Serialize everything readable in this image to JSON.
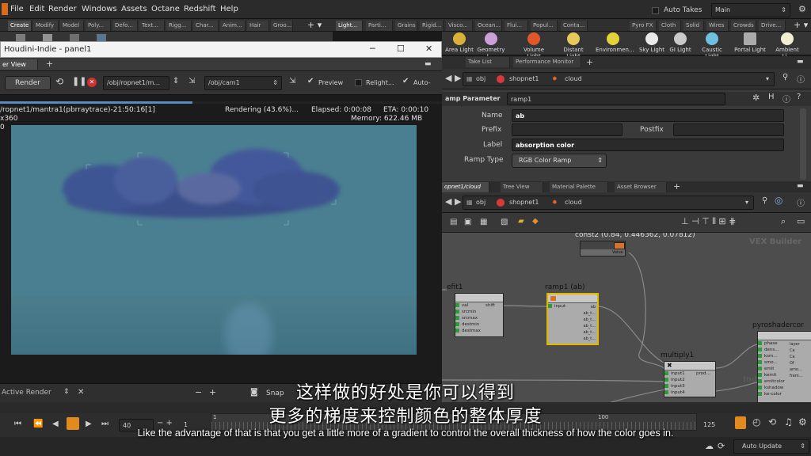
{
  "menubar": {
    "items": [
      "File",
      "Edit",
      "Render",
      "Windows",
      "Assets",
      "Octane",
      "Redshift",
      "Help"
    ],
    "auto_takes": "Auto Takes",
    "desktop": "Main"
  },
  "shelf_left": {
    "tabs": [
      "Create",
      "Modify",
      "Model",
      "Poly...",
      "Defo...",
      "Text...",
      "Rigg...",
      "Char...",
      "Anim...",
      "Hair",
      "Groo..."
    ]
  },
  "shelf_right": {
    "tabs": [
      "Light...",
      "Parti...",
      "Grains",
      "Rigid...",
      "Visco...",
      "Ocean...",
      "Flui...",
      "Popul...",
      "Conta...",
      "Pyro FX",
      "Cloth",
      "Solid",
      "Wires",
      "Crowds",
      "Drive..."
    ],
    "tools": [
      "Area Light",
      "Geometry L...",
      "Volume Light",
      "Distant Light",
      "Environmen...",
      "Sky Light",
      "GI Light",
      "Caustic Light",
      "Portal Light",
      "Ambient Li..."
    ]
  },
  "render_panel": {
    "window_title": "Houdini-Indie - panel1",
    "tab": "er View",
    "render_button": "Render",
    "rop_path": "/obj/ropnet1/m...",
    "camera_path": "/obj/cam1",
    "preview": "Preview",
    "relight": "Relight...",
    "auto": "Auto-",
    "status_name": "/ropnet1/mantra1(pbrraytrace)-21:50:16[1]",
    "resolution": "x360",
    "rendering": "Rendering (43.6%)...",
    "elapsed": "Elapsed: 0:00:08",
    "eta": "ETA: 0:00:10",
    "memory": "Memory:  622.46 MB",
    "zero": "0",
    "progress": 0.436
  },
  "active_render": {
    "label": "Active Render",
    "snap": "Snap"
  },
  "param_pane": {
    "tabs": [
      "Take List",
      "Performance Monitor"
    ],
    "path": [
      "obj",
      "shopnet1",
      "cloud"
    ],
    "header_label": "amp Parameter",
    "header_value": "ramp1",
    "name_label": "Name",
    "name_value": "ab",
    "prefix_label": "Prefix",
    "postfix_label": "Postfix",
    "label_label": "Label",
    "label_value": "absorption color",
    "ramp_type_label": "Ramp Type",
    "ramp_type_value": "RGB Color Ramp"
  },
  "network_pane": {
    "tabs": [
      "opnet1/cloud",
      "Tree View",
      "Material Palette",
      "Asset Browser"
    ],
    "path": [
      "obj",
      "shopnet1",
      "cloud"
    ],
    "watermark_top": "VEX Builder",
    "watermark_bottom": "Indie Edition",
    "nodes": {
      "const2": {
        "label": "const2 (0.84, 0.446362, 0.07812)",
        "output": "Value"
      },
      "fit": {
        "label": "efit1",
        "inputs": [
          "val",
          "srcmin",
          "srcmax",
          "destmin",
          "destmax"
        ],
        "output": "shift"
      },
      "ramp": {
        "label": "ramp1 (ab)",
        "input": "input",
        "outputs": [
          "ab",
          "ab_t...",
          "ab_t...",
          "ab_t...",
          "ab_t...",
          "ab_t..."
        ]
      },
      "multiply": {
        "label": "multiply1",
        "inputs": [
          "input1",
          "input2",
          "input3",
          "input4"
        ],
        "output": "prod..."
      },
      "pyro": {
        "label": "pyroshadercor",
        "inputs": [
          "phase",
          "dens...",
          "ksm...",
          "smo...",
          "emit",
          "kemit",
          "emitcolor",
          "kshadow",
          "ke-color"
        ],
        "outputs": [
          "layer",
          "Ce",
          "Ce",
          "Of",
          "amo...",
          "frem..."
        ]
      }
    }
  },
  "timeline": {
    "frame_start": "1",
    "frame_current": "40",
    "tick_1": "1",
    "tick_100": "100",
    "frame_end": "125"
  },
  "statusbar": {
    "auto_update": "Auto Update"
  },
  "subtitles": {
    "zh_line1": "这样做的好处是你可以得到",
    "zh_line2": "更多的梯度来控制颜色的整体厚度",
    "en_line": "Like the advantage of that is that you get a little more of a gradient to control the overall thickness of how the color goes in."
  },
  "colors": {
    "sky": "#4a7f91",
    "cloud": "#3a4f8a",
    "ramp_border": "#e0b800",
    "wire": "#8a8a8a"
  }
}
